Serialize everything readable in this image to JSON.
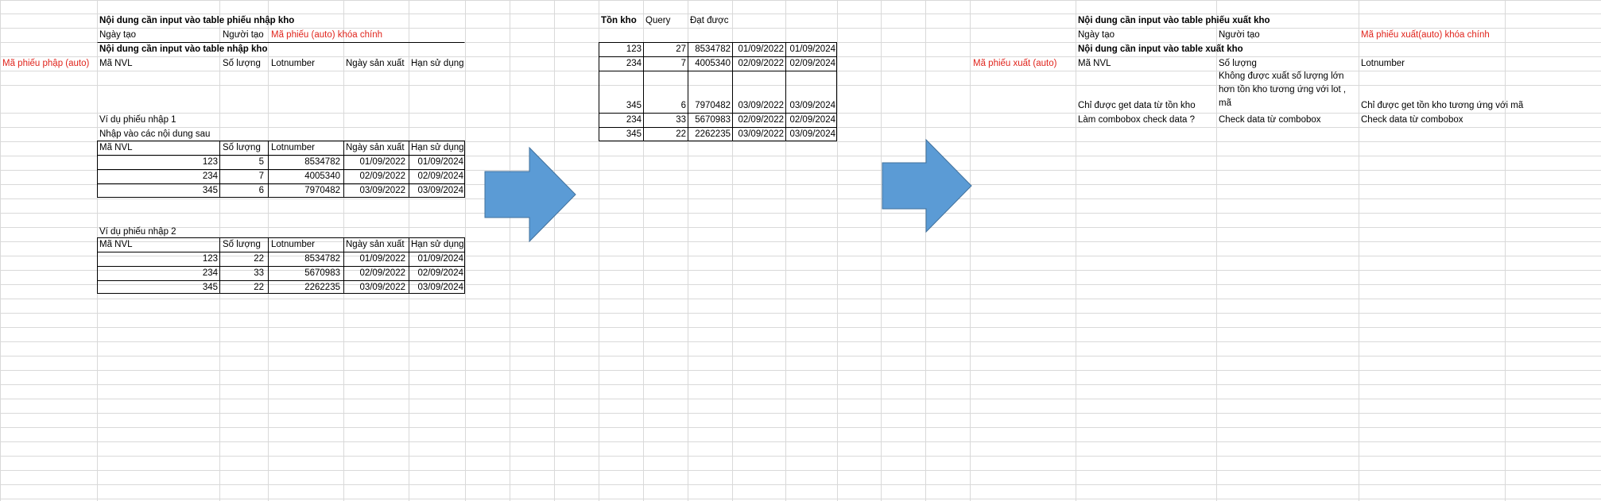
{
  "left": {
    "title": "Nội dung cần input vào table phiếu nhập kho",
    "header_row": [
      "Ngày tạo",
      "Người tạo",
      "Mã phiếu (auto) khóa chính"
    ],
    "subtitle": "Nội dung cần input vào table nhập kho",
    "col_key": "Mã phiếu phập (auto)",
    "columns": [
      "Mã NVL",
      "Số lượng",
      "Lotnumber",
      "Ngày sản xuất",
      "Hạn sử dụng"
    ],
    "example1": {
      "title": "Ví dụ phiếu nhập 1",
      "intro": "Nhập vào các nội dung sau",
      "columns": [
        "Mã NVL",
        "Số lượng",
        "Lotnumber",
        "Ngày sản xuất",
        "Hạn sử dụng"
      ],
      "rows": [
        [
          "123",
          "5",
          "8534782",
          "01/09/2022",
          "01/09/2024"
        ],
        [
          "234",
          "7",
          "4005340",
          "02/09/2022",
          "02/09/2024"
        ],
        [
          "345",
          "6",
          "7970482",
          "03/09/2022",
          "03/09/2024"
        ]
      ]
    },
    "example2": {
      "title": "Ví dụ phiếu nhập 2",
      "columns": [
        "Mã NVL",
        "Số lượng",
        "Lotnumber",
        "Ngày sản xuất",
        "Hạn sử dụng"
      ],
      "rows": [
        [
          "123",
          "22",
          "8534782",
          "01/09/2022",
          "01/09/2024"
        ],
        [
          "234",
          "33",
          "5670983",
          "02/09/2022",
          "02/09/2024"
        ],
        [
          "345",
          "22",
          "2262235",
          "03/09/2022",
          "03/09/2024"
        ]
      ]
    }
  },
  "middle": {
    "headers": [
      "Tồn kho",
      "Query",
      "Đạt được"
    ],
    "rows": [
      [
        "123",
        "27",
        "8534782",
        "01/09/2022",
        "01/09/2024"
      ],
      [
        "234",
        "7",
        "4005340",
        "02/09/2022",
        "02/09/2024"
      ],
      [
        "345",
        "6",
        "7970482",
        "03/09/2022",
        "03/09/2024"
      ],
      [
        "234",
        "33",
        "5670983",
        "02/09/2022",
        "02/09/2024"
      ],
      [
        "345",
        "22",
        "2262235",
        "03/09/2022",
        "03/09/2024"
      ]
    ]
  },
  "right": {
    "title": "Nội dung cần input vào table phiếu xuất kho",
    "header_row": [
      "Ngày tạo",
      "Người tạo",
      "Mã phiếu xuất(auto) khóa chính"
    ],
    "subtitle": "Nội dung cần input vào table xuất kho",
    "col_key": "Mã phiếu xuất (auto)",
    "columns": [
      "Mã NVL",
      "Số lượng",
      "Lotnumber"
    ],
    "note_mid": "Không được xuất số lượng lớn hơn tồn kho tương ứng với lot , mã",
    "note_left": "Chỉ được get data từ tồn kho",
    "note_right": "Chỉ được get tồn kho tương ứng với mã",
    "row_last": [
      "Làm combobox check data ?",
      "Check data từ combobox",
      "Check data từ combobox"
    ]
  },
  "colors": {
    "arrow_fill": "#5b9bd5",
    "arrow_stroke": "#41719c",
    "grid": "#d9d9d9",
    "red": "#e0241c"
  },
  "icons": [
    "right-arrow-shape",
    "right-arrow-shape"
  ]
}
